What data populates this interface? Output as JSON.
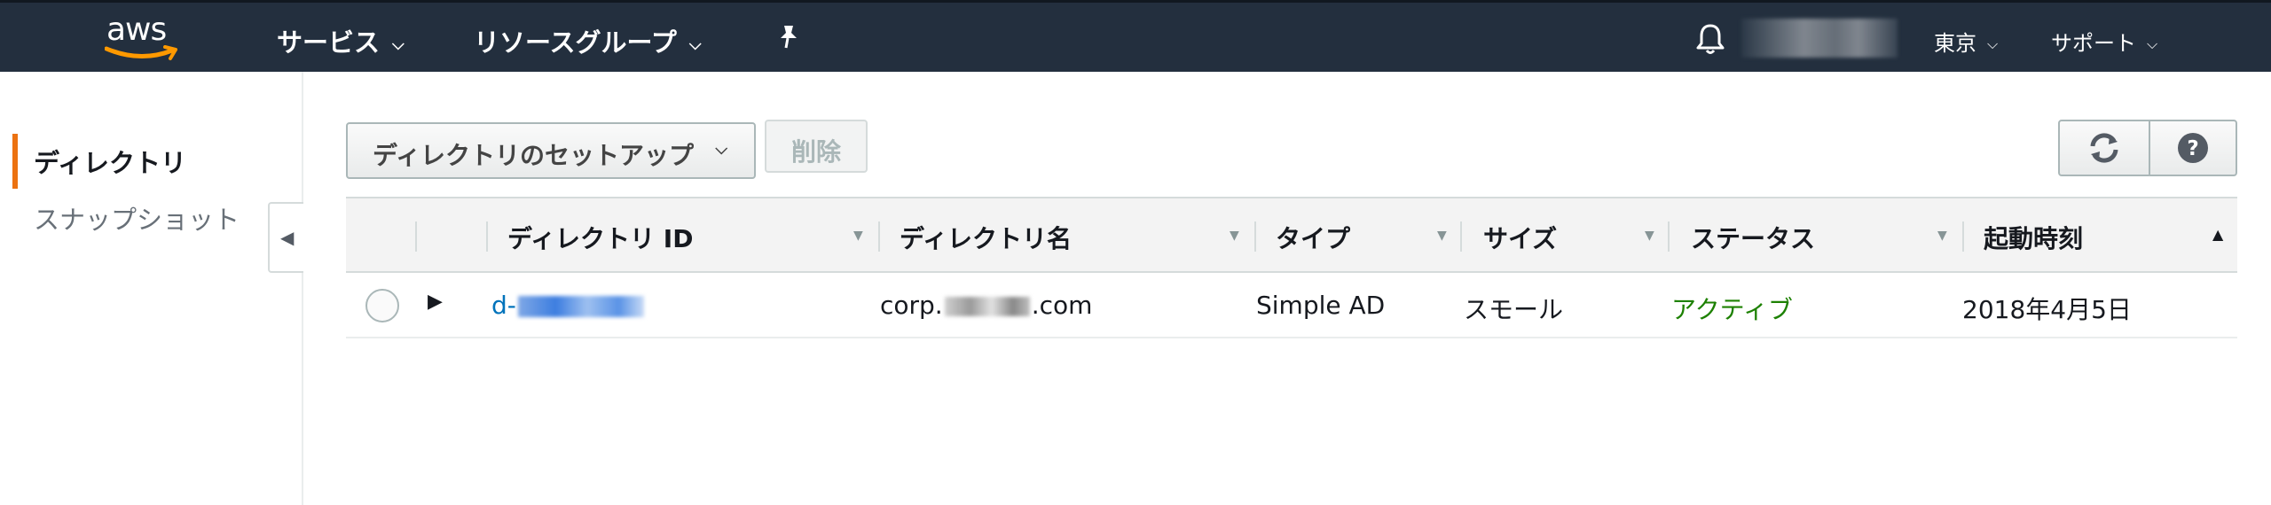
{
  "topnav": {
    "logo_text": "aws",
    "services_label": "サービス",
    "resource_groups_label": "リソースグループ",
    "region_label": "東京",
    "support_label": "サポート"
  },
  "sidebar": {
    "items": [
      {
        "label": "ディレクトリ",
        "active": true
      },
      {
        "label": "スナップショット",
        "active": false
      }
    ]
  },
  "toolbar": {
    "setup_label": "ディレクトリのセットアップ",
    "delete_label": "削除"
  },
  "table": {
    "columns": [
      "ディレクトリ ID",
      "ディレクトリ名",
      "タイプ",
      "サイズ",
      "ステータス",
      "起動時刻"
    ],
    "rows": [
      {
        "directory_id": "d-",
        "directory_name_prefix": "corp.",
        "directory_name_suffix": ".com",
        "type": "Simple AD",
        "size": "スモール",
        "status": "アクティブ",
        "launch_time": "2018年4月5日"
      }
    ]
  },
  "colors": {
    "nav_bg": "#232f3e",
    "accent_orange": "#ec7211",
    "link_blue": "#0073bb",
    "status_green": "#1d8102"
  }
}
